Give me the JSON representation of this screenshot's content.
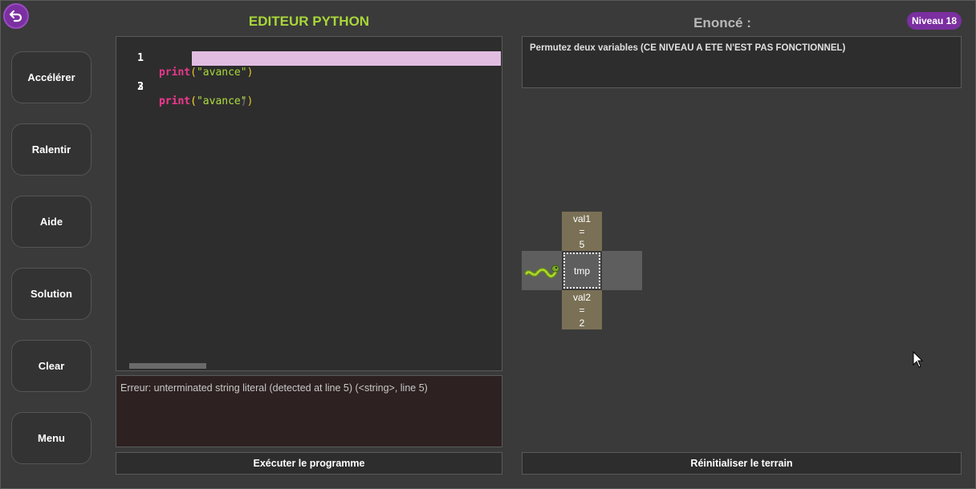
{
  "sidebar": {
    "buttons": [
      {
        "label": "Accélérer"
      },
      {
        "label": "Ralentir"
      },
      {
        "label": "Aide"
      },
      {
        "label": "Solution"
      },
      {
        "label": "Clear"
      },
      {
        "label": "Menu"
      }
    ]
  },
  "editor": {
    "title": "EDITEUR PYTHON",
    "lines": [
      {
        "num": "1",
        "kw": "print",
        "open": "(",
        "str": "\"avance\"",
        "close": ")"
      },
      {
        "num": "2",
        "kw": "print",
        "open": "(",
        "str": "\"avance)",
        "close": ""
      },
      {
        "num": "3",
        "kw": "print",
        "open": "(",
        "str": "\"avance\"",
        "close": ")"
      }
    ],
    "highlighted_line": 2
  },
  "console": {
    "text": "Erreur: unterminated string literal (detected at line 5) (<string>, line 5)"
  },
  "run_button": {
    "label": "Exécuter le programme"
  },
  "enonce": {
    "title": "Enoncé :",
    "text": "Permutez deux variables (CE NIVEAU A ETE N'EST PAS FONCTIONNEL)"
  },
  "level_badge": {
    "label": "Niveau 18"
  },
  "board": {
    "val1": {
      "name": "val1",
      "eq": "=",
      "value": "5"
    },
    "tmp": {
      "name": "tmp"
    },
    "val2": {
      "name": "val2",
      "eq": "=",
      "value": "2"
    }
  },
  "reset_button": {
    "label": "Réinitialiser le terrain"
  },
  "colors": {
    "accent_purple": "#7b2fa0",
    "title_green": "#a8d63a",
    "keyword_pink": "#e8388c",
    "line_highlight": "#e2bde2"
  }
}
